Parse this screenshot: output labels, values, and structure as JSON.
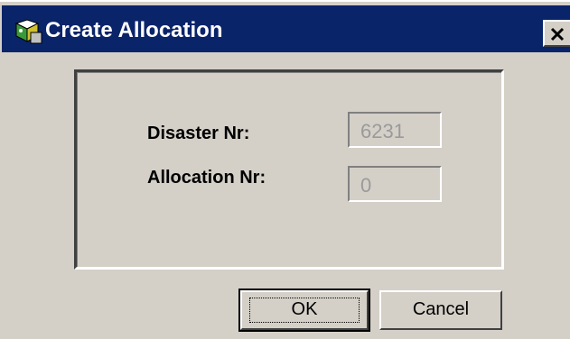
{
  "window": {
    "title": "Create Allocation",
    "icon": "app-icon",
    "close_icon": "close-icon",
    "title_bar_color": "#0a246a",
    "background_color": "#d4d0c8"
  },
  "form": {
    "disaster_label": "Disaster Nr:",
    "disaster_value": "6231",
    "allocation_label": "Allocation Nr:",
    "allocation_value": "0"
  },
  "buttons": {
    "ok_label": "OK",
    "cancel_label": "Cancel"
  }
}
